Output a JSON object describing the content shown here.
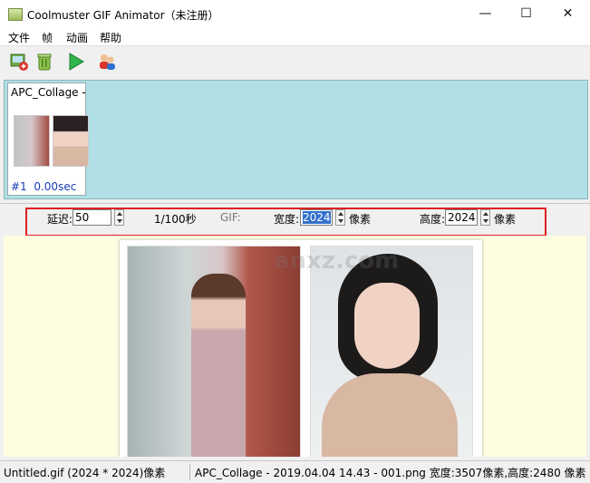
{
  "window": {
    "title": "Coolmuster GIF Animator（未注册）",
    "minimize_icon": "minimize-icon",
    "maximize_icon": "maximize-icon",
    "close_icon": "close-icon"
  },
  "menu": [
    "文件",
    "帧",
    "动画",
    "帮助"
  ],
  "toolbar": {
    "buttons": [
      {
        "name": "add-image-button",
        "icon": "add-image-icon"
      },
      {
        "name": "delete-button",
        "icon": "trash-icon"
      },
      {
        "name": "play-button",
        "icon": "play-icon"
      },
      {
        "name": "users-button",
        "icon": "users-icon"
      }
    ]
  },
  "filmstrip": {
    "frames": [
      {
        "title": "APC_Collage -",
        "index": "#1",
        "delay": "0.00sec"
      }
    ]
  },
  "properties": {
    "delay_label": "延迟:",
    "delay_value": "50",
    "delay_unit": "1/100秒",
    "gif_label": "GIF:",
    "width_label": "宽度:",
    "width_value": "2024",
    "width_unit": "像素",
    "height_label": "高度:",
    "height_value": "2024",
    "height_unit": "像素"
  },
  "preview": {
    "watermark": "anxz.com"
  },
  "status": {
    "left": "Untitled.gif (2024 * 2024)像素",
    "right": "APC_Collage - 2019.04.04 14.43 - 001.png 宽度:3507像素,高度:2480 像素"
  },
  "colors": {
    "filmstrip_bg": "#b0e0e6",
    "preview_bg": "#fefde0",
    "highlight": "#e02020",
    "frame_info": "#1a3cb8",
    "selection": "#3370cc"
  }
}
